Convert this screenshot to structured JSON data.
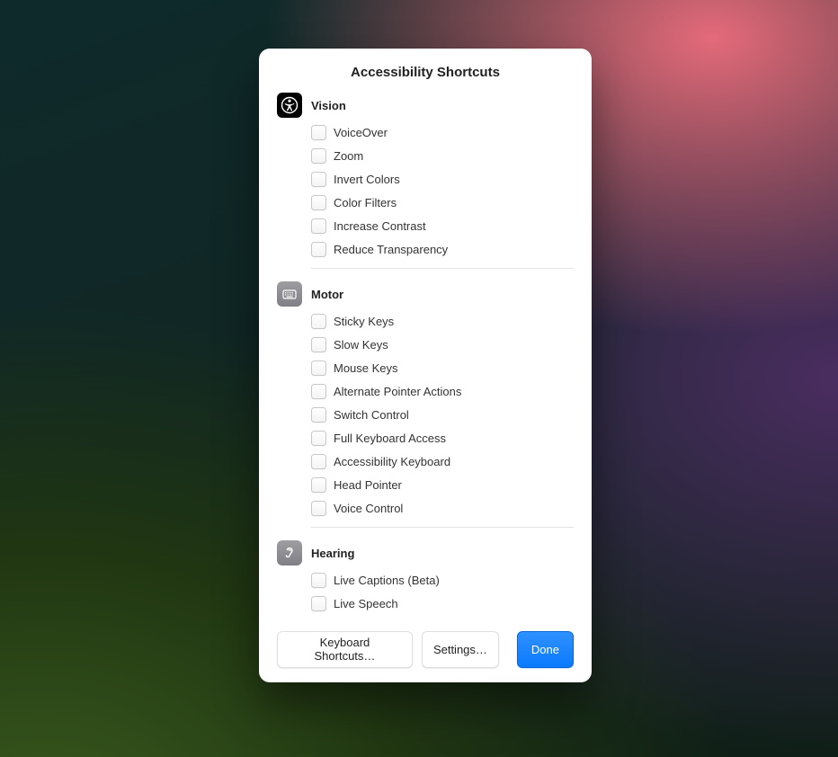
{
  "title": "Accessibility Shortcuts",
  "sections": [
    {
      "id": "vision",
      "title": "Vision",
      "icon": "accessibility-icon",
      "options": [
        "VoiceOver",
        "Zoom",
        "Invert Colors",
        "Color Filters",
        "Increase Contrast",
        "Reduce Transparency"
      ]
    },
    {
      "id": "motor",
      "title": "Motor",
      "icon": "keyboard-icon",
      "options": [
        "Sticky Keys",
        "Slow Keys",
        "Mouse Keys",
        "Alternate Pointer Actions",
        "Switch Control",
        "Full Keyboard Access",
        "Accessibility Keyboard",
        "Head Pointer",
        "Voice Control"
      ]
    },
    {
      "id": "hearing",
      "title": "Hearing",
      "icon": "ear-icon",
      "options": [
        "Live Captions (Beta)",
        "Live Speech"
      ]
    }
  ],
  "footer": {
    "keyboard": "Keyboard Shortcuts…",
    "settings": "Settings…",
    "done": "Done"
  }
}
